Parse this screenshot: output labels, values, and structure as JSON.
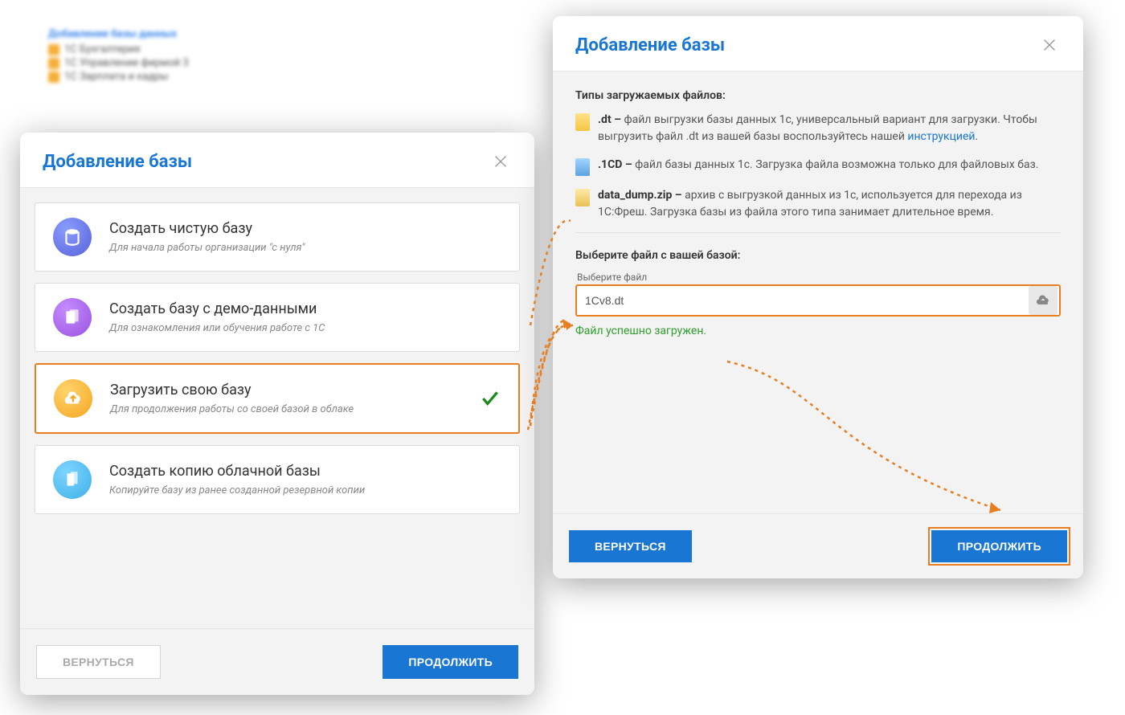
{
  "dialog1": {
    "title": "Добавление базы",
    "options": [
      {
        "title": "Создать чистую базу",
        "sub": "Для начала работы организации \"с нуля\""
      },
      {
        "title": "Создать базу с демо-данными",
        "sub": "Для ознакомления или обучения работе с 1С"
      },
      {
        "title": "Загрузить свою базу",
        "sub": "Для продолжения работы со своей базой в облаке"
      },
      {
        "title": "Создать копию облачной базы",
        "sub": "Копируйте базу из ранее созданной резервной копии"
      }
    ],
    "back": "Вернуться",
    "next": "Продолжить"
  },
  "dialog2": {
    "title": "Добавление базы",
    "types_heading": "Типы загружаемых файлов:",
    "dt_label": ".dt –",
    "dt_text": " файл выгрузки базы данных 1с, универсальный вариант для загрузки. Чтобы выгрузить файл .dt из вашей базы воспользуйтесь нашей ",
    "dt_link": "инструкцией",
    "dt_tail": ".",
    "cd_label": ".1CD –",
    "cd_text": " файл базы данных 1с. Загрузка файла возможна только для файловых баз.",
    "zip_label": "data_dump.zip –",
    "zip_text": " архив с выгрузкой данных из 1с, используется для перехода из 1С:Фреш. Загрузка базы из файла этого типа занимает длительное время.",
    "choose_heading": "Выберите файл с вашей базой:",
    "field_label": "Выберите файл",
    "field_value": "1Cv8.dt",
    "success": "Файл успешно загружен.",
    "back": "Вернуться",
    "next": "Продолжить"
  }
}
